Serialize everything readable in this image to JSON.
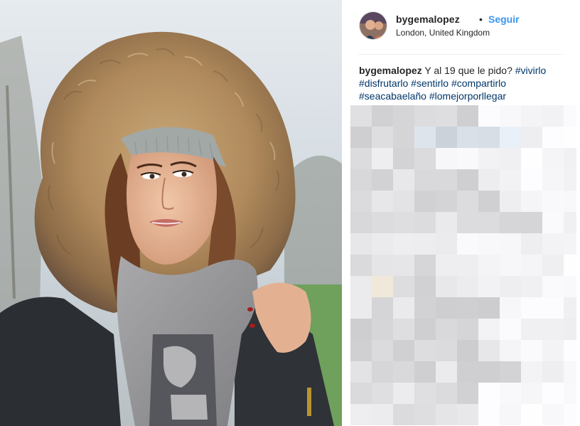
{
  "post": {
    "username": "bygemalopez",
    "separator": "•",
    "follow_label": "Seguir",
    "location": "London, United Kingdom"
  },
  "caption": {
    "username": "bygemalopez",
    "text": "Y al 19 que le pido?",
    "hashtags": [
      "#vivirlo",
      "#disfrutarlo",
      "#sentirlo",
      "#compartirlo",
      "#seacabaelaño",
      "#lomejorporllegar"
    ]
  },
  "colors": {
    "link_blue": "#3897f0",
    "hashtag": "#003569",
    "text": "#262626",
    "divider": "#efefef"
  }
}
